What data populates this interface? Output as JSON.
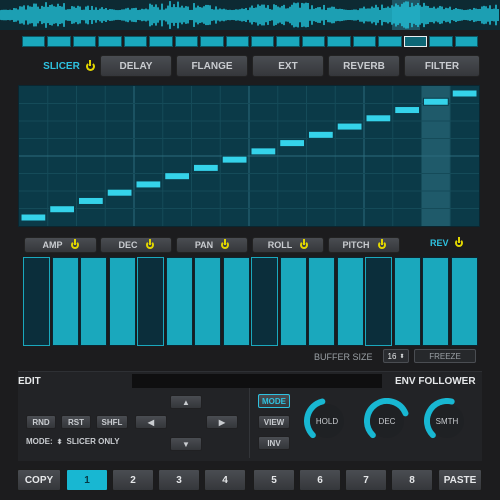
{
  "colors": {
    "accent": "#1aa8bd",
    "accent_bright": "#2ec2e0",
    "power": "#e2d600",
    "panel": "#1c1c1e",
    "grid_bg": "#0b3a48"
  },
  "effects": [
    {
      "label": "SLICER",
      "active": true
    },
    {
      "label": "DELAY"
    },
    {
      "label": "FLANGE"
    },
    {
      "label": "EXT"
    },
    {
      "label": "REVERB"
    },
    {
      "label": "FILTER"
    }
  ],
  "step_strip": {
    "count": 18,
    "selected": 15
  },
  "slicer_grid": {
    "steps": 16,
    "selected_step": 14,
    "levels": [
      1,
      2,
      3,
      4,
      5,
      6,
      7,
      8,
      9,
      10,
      11,
      12,
      13,
      14,
      15,
      16
    ]
  },
  "params": [
    {
      "label": "AMP"
    },
    {
      "label": "DEC"
    },
    {
      "label": "PAN"
    },
    {
      "label": "ROLL"
    },
    {
      "label": "PITCH"
    }
  ],
  "rev_label": "REV",
  "bars": {
    "states": [
      0,
      1,
      1,
      1,
      0,
      1,
      1,
      1,
      0,
      1,
      1,
      1,
      0,
      1,
      1,
      1
    ]
  },
  "buffer": {
    "label": "BUFFER SIZE",
    "value": "16",
    "freeze_label": "FREEZE"
  },
  "edit": {
    "title": "EDIT",
    "rnd": "RND",
    "rst": "RST",
    "shfl": "SHFL",
    "up": "▲",
    "down": "▼",
    "left": "◀",
    "right": "▶",
    "mode_label": "MODE:",
    "mode_value": "SLICER ONLY"
  },
  "env": {
    "title": "ENV FOLLOWER",
    "mode": "MODE",
    "view": "VIEW",
    "inv": "INV",
    "knobs": [
      {
        "label": "HOLD",
        "value": 0.45
      },
      {
        "label": "DEC",
        "value": 0.75
      },
      {
        "label": "SMTH",
        "value": 0.55
      }
    ]
  },
  "bottom": {
    "copy": "COPY",
    "paste": "PASTE",
    "slots": [
      "1",
      "2",
      "3",
      "4",
      "5",
      "6",
      "7",
      "8"
    ],
    "selected_slot": "1"
  }
}
